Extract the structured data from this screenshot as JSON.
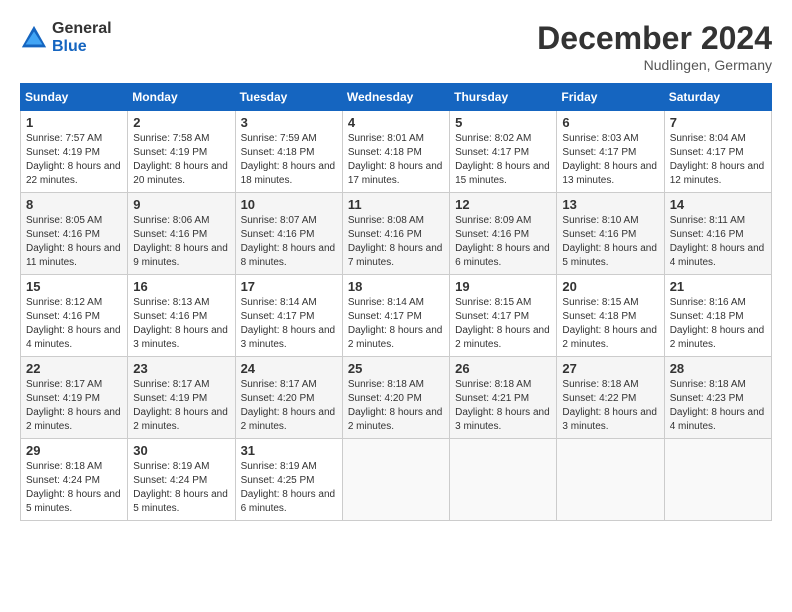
{
  "header": {
    "logo_general": "General",
    "logo_blue": "Blue",
    "month_year": "December 2024",
    "location": "Nudlingen, Germany"
  },
  "weekdays": [
    "Sunday",
    "Monday",
    "Tuesday",
    "Wednesday",
    "Thursday",
    "Friday",
    "Saturday"
  ],
  "weeks": [
    [
      {
        "day": "1",
        "sunrise": "7:57 AM",
        "sunset": "4:19 PM",
        "daylight": "8 hours and 22 minutes."
      },
      {
        "day": "2",
        "sunrise": "7:58 AM",
        "sunset": "4:19 PM",
        "daylight": "8 hours and 20 minutes."
      },
      {
        "day": "3",
        "sunrise": "7:59 AM",
        "sunset": "4:18 PM",
        "daylight": "8 hours and 18 minutes."
      },
      {
        "day": "4",
        "sunrise": "8:01 AM",
        "sunset": "4:18 PM",
        "daylight": "8 hours and 17 minutes."
      },
      {
        "day": "5",
        "sunrise": "8:02 AM",
        "sunset": "4:17 PM",
        "daylight": "8 hours and 15 minutes."
      },
      {
        "day": "6",
        "sunrise": "8:03 AM",
        "sunset": "4:17 PM",
        "daylight": "8 hours and 13 minutes."
      },
      {
        "day": "7",
        "sunrise": "8:04 AM",
        "sunset": "4:17 PM",
        "daylight": "8 hours and 12 minutes."
      }
    ],
    [
      {
        "day": "8",
        "sunrise": "8:05 AM",
        "sunset": "4:16 PM",
        "daylight": "8 hours and 11 minutes."
      },
      {
        "day": "9",
        "sunrise": "8:06 AM",
        "sunset": "4:16 PM",
        "daylight": "8 hours and 9 minutes."
      },
      {
        "day": "10",
        "sunrise": "8:07 AM",
        "sunset": "4:16 PM",
        "daylight": "8 hours and 8 minutes."
      },
      {
        "day": "11",
        "sunrise": "8:08 AM",
        "sunset": "4:16 PM",
        "daylight": "8 hours and 7 minutes."
      },
      {
        "day": "12",
        "sunrise": "8:09 AM",
        "sunset": "4:16 PM",
        "daylight": "8 hours and 6 minutes."
      },
      {
        "day": "13",
        "sunrise": "8:10 AM",
        "sunset": "4:16 PM",
        "daylight": "8 hours and 5 minutes."
      },
      {
        "day": "14",
        "sunrise": "8:11 AM",
        "sunset": "4:16 PM",
        "daylight": "8 hours and 4 minutes."
      }
    ],
    [
      {
        "day": "15",
        "sunrise": "8:12 AM",
        "sunset": "4:16 PM",
        "daylight": "8 hours and 4 minutes."
      },
      {
        "day": "16",
        "sunrise": "8:13 AM",
        "sunset": "4:16 PM",
        "daylight": "8 hours and 3 minutes."
      },
      {
        "day": "17",
        "sunrise": "8:14 AM",
        "sunset": "4:17 PM",
        "daylight": "8 hours and 3 minutes."
      },
      {
        "day": "18",
        "sunrise": "8:14 AM",
        "sunset": "4:17 PM",
        "daylight": "8 hours and 2 minutes."
      },
      {
        "day": "19",
        "sunrise": "8:15 AM",
        "sunset": "4:17 PM",
        "daylight": "8 hours and 2 minutes."
      },
      {
        "day": "20",
        "sunrise": "8:15 AM",
        "sunset": "4:18 PM",
        "daylight": "8 hours and 2 minutes."
      },
      {
        "day": "21",
        "sunrise": "8:16 AM",
        "sunset": "4:18 PM",
        "daylight": "8 hours and 2 minutes."
      }
    ],
    [
      {
        "day": "22",
        "sunrise": "8:17 AM",
        "sunset": "4:19 PM",
        "daylight": "8 hours and 2 minutes."
      },
      {
        "day": "23",
        "sunrise": "8:17 AM",
        "sunset": "4:19 PM",
        "daylight": "8 hours and 2 minutes."
      },
      {
        "day": "24",
        "sunrise": "8:17 AM",
        "sunset": "4:20 PM",
        "daylight": "8 hours and 2 minutes."
      },
      {
        "day": "25",
        "sunrise": "8:18 AM",
        "sunset": "4:20 PM",
        "daylight": "8 hours and 2 minutes."
      },
      {
        "day": "26",
        "sunrise": "8:18 AM",
        "sunset": "4:21 PM",
        "daylight": "8 hours and 3 minutes."
      },
      {
        "day": "27",
        "sunrise": "8:18 AM",
        "sunset": "4:22 PM",
        "daylight": "8 hours and 3 minutes."
      },
      {
        "day": "28",
        "sunrise": "8:18 AM",
        "sunset": "4:23 PM",
        "daylight": "8 hours and 4 minutes."
      }
    ],
    [
      {
        "day": "29",
        "sunrise": "8:18 AM",
        "sunset": "4:24 PM",
        "daylight": "8 hours and 5 minutes."
      },
      {
        "day": "30",
        "sunrise": "8:19 AM",
        "sunset": "4:24 PM",
        "daylight": "8 hours and 5 minutes."
      },
      {
        "day": "31",
        "sunrise": "8:19 AM",
        "sunset": "4:25 PM",
        "daylight": "8 hours and 6 minutes."
      },
      null,
      null,
      null,
      null
    ]
  ]
}
